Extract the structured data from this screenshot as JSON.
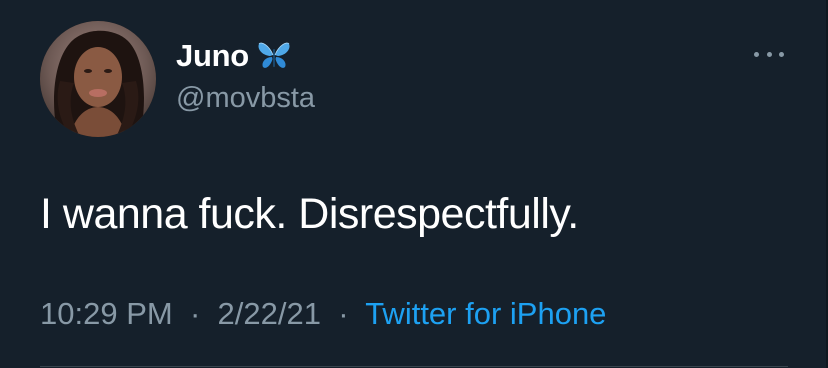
{
  "tweet": {
    "author": {
      "display_name": "Juno",
      "handle": "@movbsta",
      "verified_emoji": "butterfly-icon"
    },
    "text": "I wanna fuck. Disrespectfully.",
    "time": "10:29 PM",
    "date": "2/22/21",
    "separator": "·",
    "source": "Twitter for iPhone"
  },
  "colors": {
    "background": "#15202b",
    "primary_text": "#ffffff",
    "secondary_text": "#8899a6",
    "link": "#1da1f2"
  }
}
